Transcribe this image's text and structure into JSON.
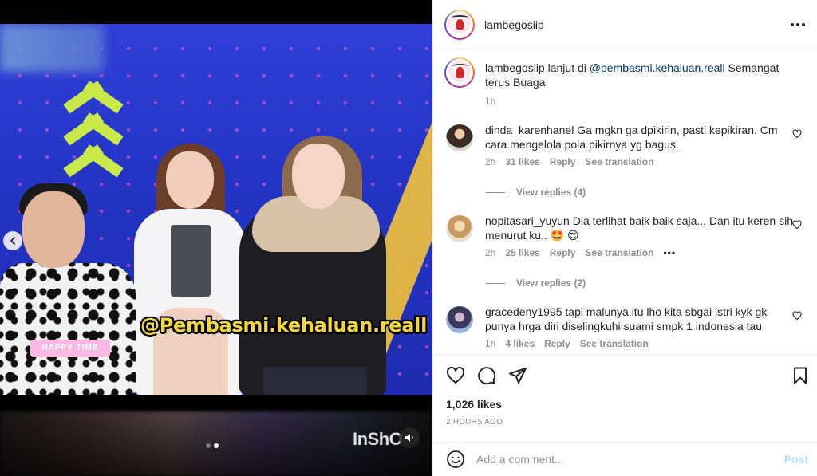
{
  "post": {
    "username": "lambegosiip",
    "caption": {
      "username": "lambegosiip",
      "text_before": "lanjut di",
      "mention": "@pembasmi.kehaluan.reall",
      "text_after": "Semangat terus Buaga",
      "time": "1h"
    },
    "media": {
      "overlay_text": "@Pembasmi.kehaluan.reall",
      "card_text": "HAPPY TIME",
      "watermark": "InShO",
      "carousel_total": 2,
      "carousel_active": 2
    }
  },
  "comments": [
    {
      "username": "dinda_karenhanel",
      "text": "Ga mgkn ga dpikirin, pasti kepikiran. Cm cara mengelola pola pikirnya yg bagus.",
      "time": "2h",
      "likes": "31 likes",
      "reply_label": "Reply",
      "translate_label": "See translation",
      "view_replies": "View replies (4)",
      "avatar_icon": "profile-photo"
    },
    {
      "username": "nopitasari_yuyun",
      "text": "Dia terlihat baik baik saja... Dan itu keren sih menurut ku.. 🤩 😍",
      "time": "2h",
      "likes": "25 likes",
      "reply_label": "Reply",
      "translate_label": "See translation",
      "more_label": "•••",
      "view_replies": "View replies (2)",
      "avatar_icon": "profile-photo"
    },
    {
      "username": "gracedeny1995",
      "text": "tapi malunya itu lho kita sbgai istri kyk gk punya hrga diri diselingkuhi suami smpk 1 indonesia tau",
      "time": "1h",
      "likes": "4 likes",
      "reply_label": "Reply",
      "translate_label": "See translation",
      "avatar_icon": "profile-photo"
    }
  ],
  "actions": {
    "icons": [
      "heart-icon",
      "comment-icon",
      "share-icon",
      "bookmark-icon"
    ],
    "likes": "1,026 likes",
    "time": "2 HOURS AGO"
  },
  "add_comment": {
    "placeholder": "Add a comment...",
    "post_label": "Post"
  },
  "colors": {
    "link": "#00376b",
    "muted": "#8e8e8e",
    "post_disabled": "#b2dffc",
    "overlay_text": "#f5d63a"
  }
}
